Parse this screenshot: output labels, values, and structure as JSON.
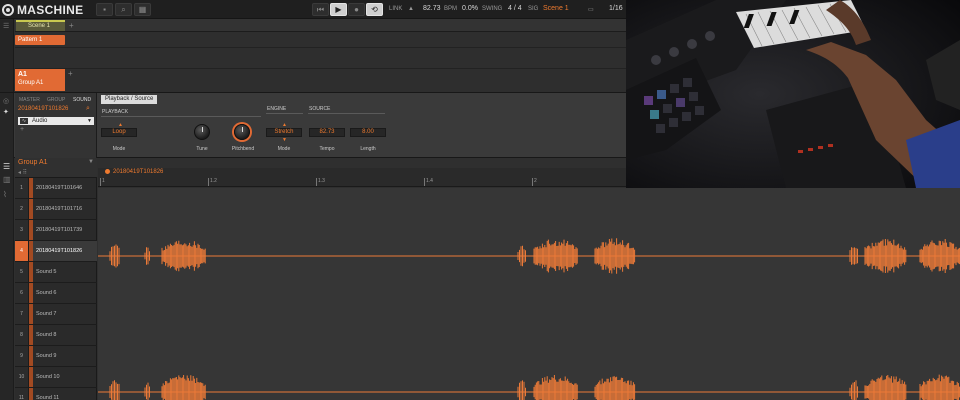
{
  "app": {
    "logo_text": "MASCHINE"
  },
  "transport": {
    "link": "LINK",
    "bpm_value": "82.73",
    "bpm_label": "BPM",
    "swing_value": "0.0%",
    "swing_label": "SWING",
    "signature": "4 / 4",
    "sig_label": "SIG",
    "scene_display": "Scene 1",
    "position": "1/16"
  },
  "arranger": {
    "scene_label": "Scene 1",
    "pattern_label": "Pattern 1",
    "group_id": "A1",
    "group_name": "Group A1",
    "plus": "+"
  },
  "control": {
    "tabs": [
      "MASTER",
      "GROUP",
      "SOUND"
    ],
    "sound_name": "20180419T101826",
    "plugin_name": "Audio",
    "plus": "+",
    "page_tab": "Playback / Source",
    "sections": {
      "playback": "PLAYBACK",
      "engine": "ENGINE",
      "source": "SOURCE"
    },
    "params": {
      "mode1_value": "Loop",
      "mode1_label": "Mode",
      "tune_label": "Tune",
      "pitchbend_label": "Pitchbend",
      "mode2_value": "Stretch",
      "mode2_label": "Mode",
      "tempo_value": "82.73",
      "tempo_label": "Tempo",
      "length_value": "8.00",
      "length_label": "Length"
    }
  },
  "editor": {
    "group_name": "Group A1",
    "clip_name": "20180419T101826",
    "ruler_labels": [
      "1",
      "1.2",
      "1.3",
      "1.4",
      "2"
    ],
    "sounds": [
      {
        "num": "1",
        "name": "20180419T101646"
      },
      {
        "num": "2",
        "name": "20180419T101716"
      },
      {
        "num": "3",
        "name": "20180419T101739"
      },
      {
        "num": "4",
        "name": "20180419T101826"
      },
      {
        "num": "5",
        "name": "Sound 5"
      },
      {
        "num": "6",
        "name": "Sound 6"
      },
      {
        "num": "7",
        "name": "Sound 7"
      },
      {
        "num": "8",
        "name": "Sound 8"
      },
      {
        "num": "9",
        "name": "Sound 9"
      },
      {
        "num": "10",
        "name": "Sound 10"
      },
      {
        "num": "11",
        "name": "Sound 11"
      }
    ],
    "selected_index": 3
  },
  "colors": {
    "accent": "#e16a34",
    "scene": "#c9c950",
    "waveform": "#ec7a38"
  }
}
